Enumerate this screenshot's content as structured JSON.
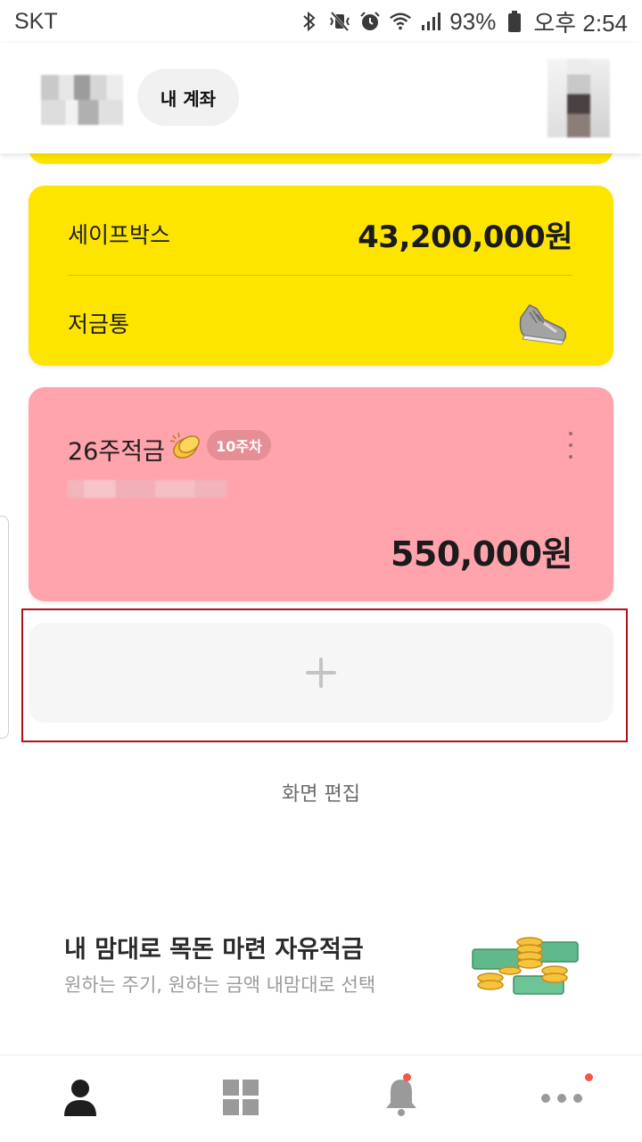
{
  "status_bar": {
    "carrier": "SKT",
    "battery_percent": "93%",
    "time": "오후 2:54",
    "icons": [
      "bluetooth-icon",
      "vibrate-mute-icon",
      "alarm-icon",
      "wifi-icon",
      "signal-icon",
      "battery-icon"
    ]
  },
  "header": {
    "my_account_label": "내 계좌"
  },
  "safebox": {
    "label": "세이프박스",
    "amount": "43,200,000원",
    "piggy_label": "저금통",
    "card_color": "#fee500"
  },
  "savings": {
    "title": "26주적금",
    "week_badge": "10주차",
    "amount": "550,000원",
    "card_color": "#ffa4ad"
  },
  "edit_screen_label": "화면 편집",
  "promo": {
    "title": "내 맘대로 목돈 마련 자유적금",
    "subtitle": "원하는 주기, 원하는 금액 내맘대로 선택"
  },
  "bottom_nav": {
    "items": [
      "person-icon",
      "grid-icon",
      "bell-icon",
      "more-icon"
    ],
    "notification_dot_color": "#f15846"
  }
}
